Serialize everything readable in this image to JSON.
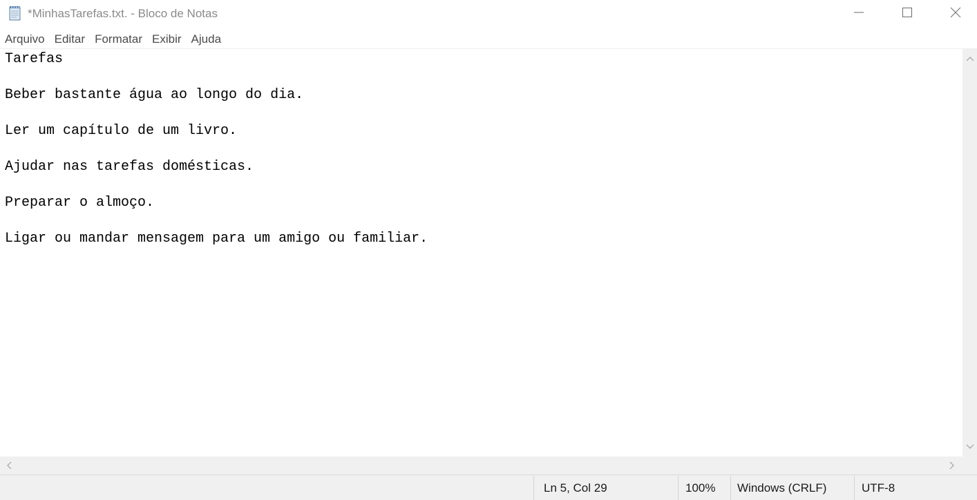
{
  "window": {
    "title": "*MinhasTarefas.txt. - Bloco de Notas",
    "app_icon": "notepad-icon",
    "controls": {
      "minimize_icon": "minimize-icon",
      "maximize_icon": "maximize-icon",
      "close_icon": "close-icon"
    }
  },
  "menubar": {
    "items": [
      {
        "label": "Arquivo"
      },
      {
        "label": "Editar"
      },
      {
        "label": "Formatar"
      },
      {
        "label": "Exibir"
      },
      {
        "label": "Ajuda"
      }
    ]
  },
  "editor": {
    "lines": [
      "Tarefas",
      "",
      "Beber bastante água ao longo do dia.",
      "",
      "Ler um capítulo de um livro.",
      "",
      "Ajudar nas tarefas domésticas.",
      "",
      "Preparar o almoço.",
      "",
      "Ligar ou mandar mensagem para um amigo ou familiar."
    ]
  },
  "statusbar": {
    "position": "Ln 5, Col 29",
    "zoom": "100%",
    "line_ending": "Windows (CRLF)",
    "encoding": "UTF-8"
  },
  "colors": {
    "title_text": "#8a8a8a",
    "menu_text": "#4a4a4a",
    "editor_text": "#000000",
    "chrome_background": "#f0f0f0"
  }
}
